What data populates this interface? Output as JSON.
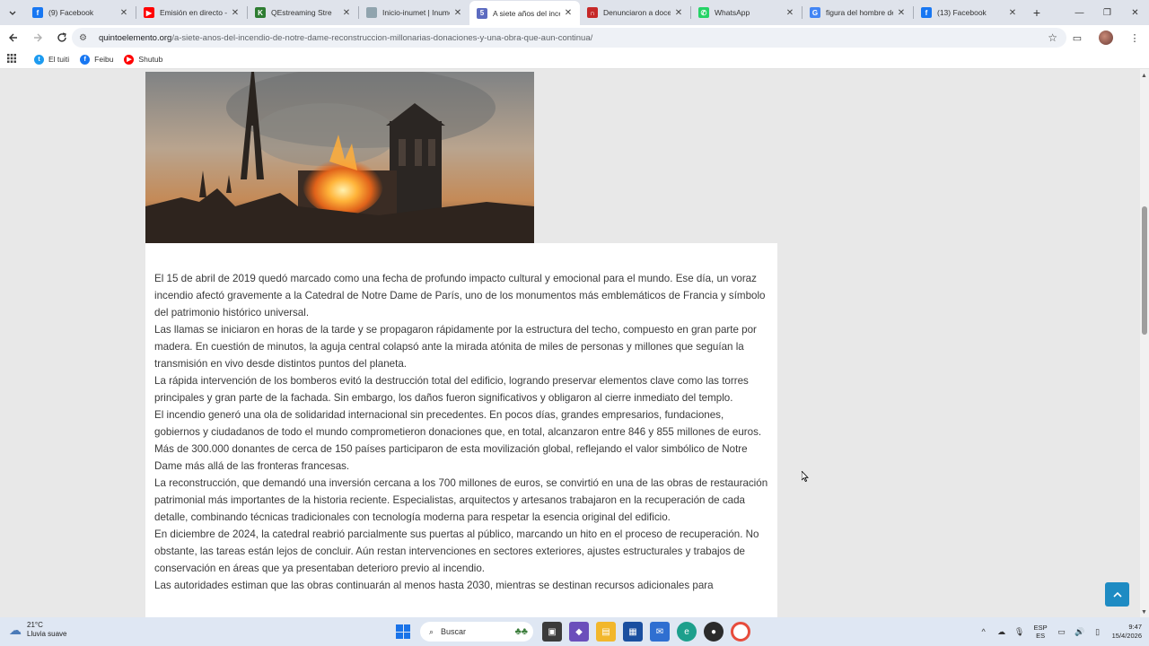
{
  "tabs": [
    {
      "title": "(9) Facebook",
      "favicon": "facebook-icon",
      "color": "#1877f2",
      "glyph": "f"
    },
    {
      "title": "Emisión en directo - Y",
      "favicon": "youtube-icon",
      "color": "#ff0000",
      "glyph": "▶"
    },
    {
      "title": "QEstreaming Stre",
      "favicon": "streaming-icon",
      "color": "#2e7d32",
      "glyph": "K"
    },
    {
      "title": "Inicio-inumet | Inume",
      "favicon": "page-icon",
      "color": "#90a4ae",
      "glyph": ""
    },
    {
      "title": "A siete años del ince",
      "favicon": "quintoelemento-icon",
      "color": "#5c6bc0",
      "glyph": "5",
      "active": true
    },
    {
      "title": "Denunciaron a docer",
      "favicon": "news-icon",
      "color": "#c62828",
      "glyph": "∩"
    },
    {
      "title": "WhatsApp",
      "favicon": "whatsapp-icon",
      "color": "#25d366",
      "glyph": "✆"
    },
    {
      "title": "figura del hombre de",
      "favicon": "google-icon",
      "color": "#4285f4",
      "glyph": "G"
    },
    {
      "title": "(13) Facebook",
      "favicon": "facebook-icon",
      "color": "#1877f2",
      "glyph": "f"
    }
  ],
  "toolbar": {
    "url_host": "quintoelemento.org",
    "url_path": "/a-siete-anos-del-incendio-de-notre-dame-reconstruccion-millonarias-donaciones-y-una-obra-que-aun-continua/"
  },
  "bookmarks": [
    {
      "label": "El tuiti",
      "icon": "twitter-icon",
      "color": "#1d9bf0",
      "glyph": "t"
    },
    {
      "label": "Feibu",
      "icon": "facebook-icon",
      "color": "#1877f2",
      "glyph": "f"
    },
    {
      "label": "Shutub",
      "icon": "youtube-icon",
      "color": "#ff0000",
      "glyph": "▶"
    }
  ],
  "article": {
    "paragraphs": [
      "El 15 de abril de 2019 quedó marcado como una fecha de profundo impacto cultural y emocional para el mundo. Ese día, un voraz incendio afectó gravemente a la Catedral de Notre Dame de París, uno de los monumentos más emblemáticos de Francia y símbolo del patrimonio histórico universal.",
      "Las llamas se iniciaron en horas de la tarde y se propagaron rápidamente por la estructura del techo, compuesto en gran parte por madera. En cuestión de minutos, la aguja central colapsó ante la mirada atónita de miles de personas y millones que seguían la transmisión en vivo desde distintos puntos del planeta.",
      "La rápida intervención de los bomberos evitó la destrucción total del edificio, logrando preservar elementos clave como las torres principales y gran parte de la fachada. Sin embargo, los daños fueron significativos y obligaron al cierre inmediato del templo.",
      "El incendio generó una ola de solidaridad internacional sin precedentes. En pocos días, grandes empresarios, fundaciones, gobiernos y ciudadanos de todo el mundo comprometieron donaciones que, en total, alcanzaron entre 846 y 855 millones de euros. Más de 300.000 donantes de cerca de 150 países participaron de esta movilización global, reflejando el valor simbólico de Notre Dame más allá de las fronteras francesas.",
      "La reconstrucción, que demandó una inversión cercana a los 700 millones de euros, se convirtió en una de las obras de restauración patrimonial más importantes de la historia reciente. Especialistas, arquitectos y artesanos trabajaron en la recuperación de cada detalle, combinando técnicas tradicionales con tecnología moderna para respetar la esencia original del edificio.",
      "En diciembre de 2024, la catedral reabrió parcialmente sus puertas al público, marcando un hito en el proceso de recuperación. No obstante, las tareas están lejos de concluir. Aún restan intervenciones en sectores exteriores, ajustes estructurales y trabajos de conservación en áreas que ya presentaban deterioro previo al incendio.",
      "Las autoridades estiman que las obras continuarán al menos hasta 2030, mientras se destinan recursos adicionales para"
    ]
  },
  "taskbar": {
    "weather_temp": "21°C",
    "weather_desc": "Lluvia suave",
    "search_placeholder": "Buscar",
    "lang_1": "ESP",
    "lang_2": "ES",
    "time": "9:47",
    "date": "15/4/2026"
  }
}
